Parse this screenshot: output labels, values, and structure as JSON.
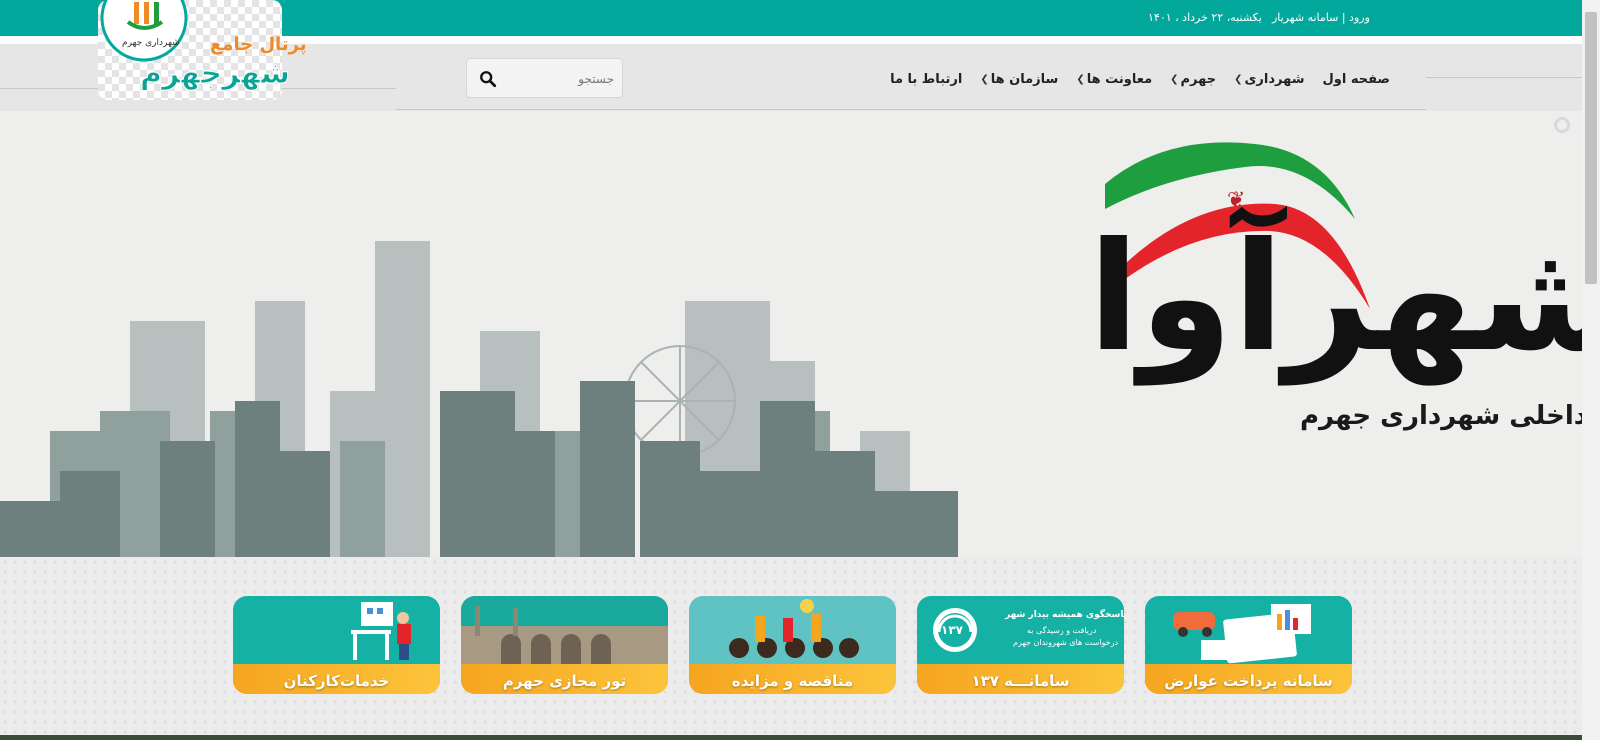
{
  "topbar": {
    "login_label": "ورود | سامانه شهریار",
    "separator": "-",
    "date": "یکشنبه، ۲۲ خرداد ، ۱۴۰۱"
  },
  "logo": {
    "line1": "پرتال جامع",
    "line2": "شهرجهرم",
    "seal_text": "شهرداری جهرم"
  },
  "nav": {
    "items": [
      {
        "label": "صفحه اول",
        "dropdown": false
      },
      {
        "label": "شهرداری",
        "dropdown": true
      },
      {
        "label": "جهرم",
        "dropdown": true
      },
      {
        "label": "معاونت ها",
        "dropdown": true
      },
      {
        "label": "سازمان ها",
        "dropdown": true
      },
      {
        "label": "ارتباط با ما",
        "dropdown": false
      }
    ]
  },
  "search": {
    "placeholder": "جستجو"
  },
  "hero": {
    "title": "شهرآوا",
    "subtitle": "گاهنامه داخلی شهرداری جهرم"
  },
  "tiles": [
    {
      "label": "سامانه پرداخت عوارض"
    },
    {
      "label": "سامانـــه ۱۳۷",
      "headline": "پاسخگوی همیشه بیدار شهر",
      "sub1": "دریافت و رسیدگی به",
      "sub2": "درخواست های شهروندان جهرم",
      "badge": "۱۳۷"
    },
    {
      "label": "مناقصه و مزایده"
    },
    {
      "label": "تور مجازی جهرم"
    },
    {
      "label": "خدمات‌کارکنان"
    }
  ],
  "colors": {
    "accent": "#03a89d",
    "tile_teal": "#14b1a4",
    "tile_orange": "#f6a51f",
    "logo_orange": "#f08a24",
    "flag_green": "#1e9e3e",
    "flag_red": "#e3242b"
  }
}
